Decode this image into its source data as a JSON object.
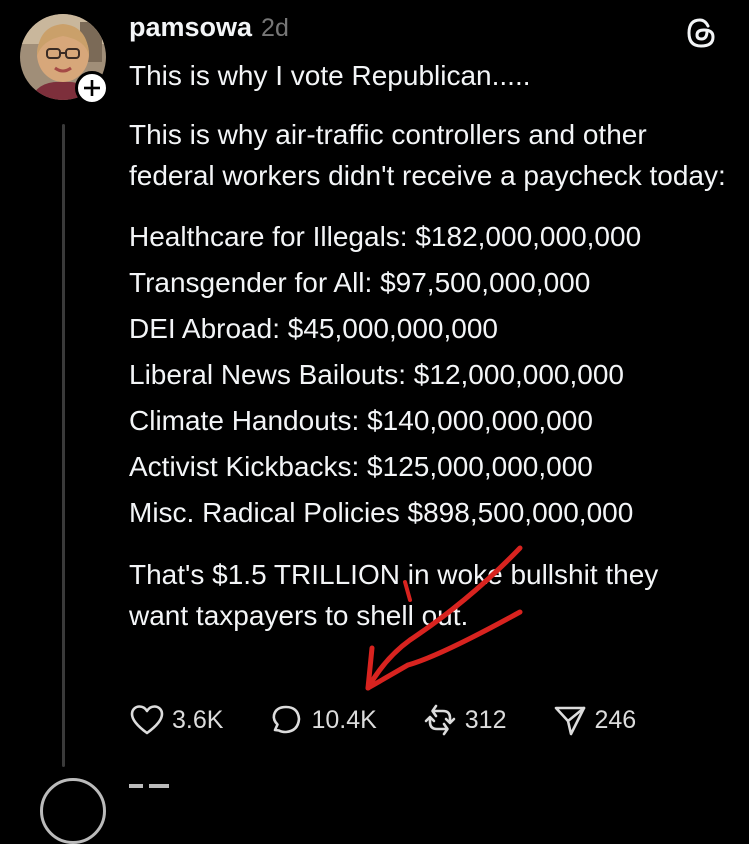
{
  "post": {
    "username": "pamsowa",
    "time": "2d",
    "paragraphs": [
      "This is why I vote Republican.....",
      "This is why air-traffic controllers and other federal workers didn't receive a paycheck today:"
    ],
    "items": [
      "Healthcare for Illegals: $182,000,000,000",
      "Transgender for All: $97,500,000,000",
      "DEI Abroad: $45,000,000,000",
      "Liberal News Bailouts: $12,000,000,000",
      "Climate Handouts: $140,000,000,000",
      "Activist Kickbacks: $125,000,000,000",
      "Misc. Radical Policies $898,500,000,000"
    ],
    "closing_line1": "That's $1.5 TRILLION in woke bullshit they",
    "closing_line2": "want taxpayers to shell out."
  },
  "actions": {
    "likes": "3.6K",
    "replies": "10.4K",
    "reposts": "312",
    "shares": "246"
  },
  "colors": {
    "background": "#000000",
    "text": "#f3f5f7",
    "muted": "#777777",
    "annotation_red": "#d8231f"
  },
  "icons": [
    "avatar",
    "follow-plus-icon",
    "threads-logo-icon",
    "heart-icon",
    "reply-icon",
    "repost-icon",
    "share-icon"
  ]
}
